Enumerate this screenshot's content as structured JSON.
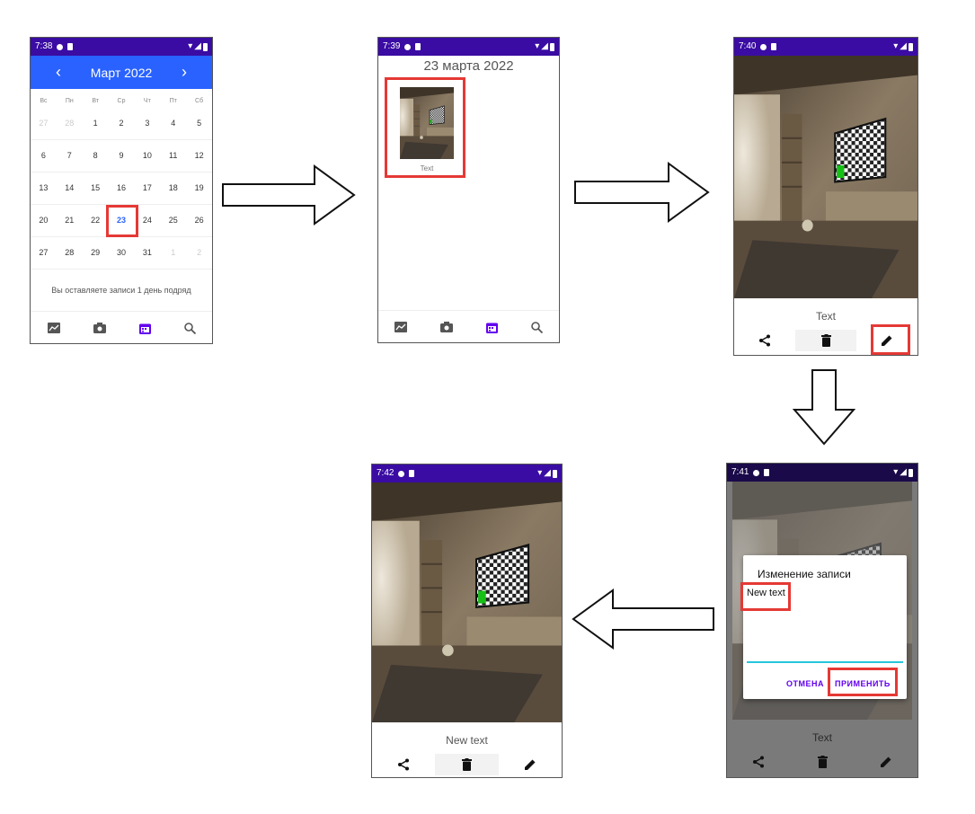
{
  "phone1": {
    "time": "7:38",
    "month_title": "Март  2022",
    "prev": "‹",
    "next": "›",
    "weekdays": [
      "Вс",
      "Пн",
      "Вт",
      "Ср",
      "Чт",
      "Пт",
      "Сб"
    ],
    "weeks": [
      [
        "27",
        "28",
        "1",
        "2",
        "3",
        "4",
        "5"
      ],
      [
        "6",
        "7",
        "8",
        "9",
        "10",
        "11",
        "12"
      ],
      [
        "13",
        "14",
        "15",
        "16",
        "17",
        "18",
        "19"
      ],
      [
        "20",
        "21",
        "22",
        "23",
        "24",
        "25",
        "26"
      ],
      [
        "27",
        "28",
        "29",
        "30",
        "31",
        "1",
        "2"
      ]
    ],
    "streak_text": "Вы оставляете записи 1 день подряд",
    "nav_icons": [
      "chart-icon",
      "camera-icon",
      "calendar-icon",
      "search-icon"
    ]
  },
  "phone2": {
    "time": "7:39",
    "date_title": "23 марта 2022",
    "thumb_caption": "Text"
  },
  "phone3": {
    "time": "7:40",
    "caption": "Text"
  },
  "phone4": {
    "time": "7:41",
    "dialog_title": "Изменение записи",
    "dialog_value": "New text",
    "cancel_label": "ОТМЕНА",
    "apply_label": "ПРИМЕНИТЬ",
    "caption": "Text"
  },
  "phone5": {
    "time": "7:42",
    "caption": "New text"
  },
  "colors": {
    "status_bar": "#3a0ca3",
    "calendar_header": "#2962ff",
    "highlight": "#e53935",
    "accent_purple": "#6200ee",
    "selected_day": "#2962ff"
  }
}
